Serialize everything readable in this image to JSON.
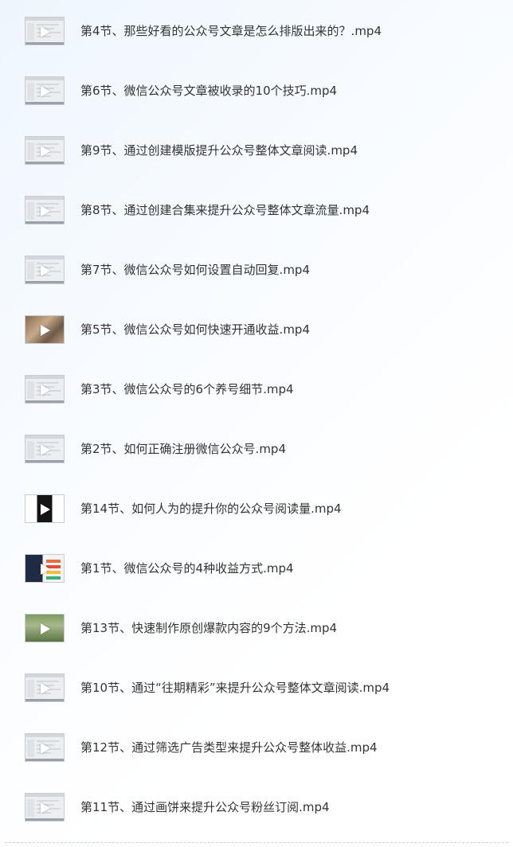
{
  "files": [
    {
      "name": "第4节、那些好看的公众号文章是怎么排版出来的？.mp4",
      "thumb_style": "screen"
    },
    {
      "name": "第6节、微信公众号文章被收录的10个技巧.mp4",
      "thumb_style": "screen"
    },
    {
      "name": "第9节、通过创建模版提升公众号整体文章阅读.mp4",
      "thumb_style": "screen"
    },
    {
      "name": "第8节、通过创建合集来提升公众号整体文章流量.mp4",
      "thumb_style": "screen"
    },
    {
      "name": "第7节、微信公众号如何设置自动回复.mp4",
      "thumb_style": "screen"
    },
    {
      "name": "第5节、微信公众号如何快速开通收益.mp4",
      "thumb_style": "photo"
    },
    {
      "name": "第3节、微信公众号的6个养号细节.mp4",
      "thumb_style": "screen"
    },
    {
      "name": "第2节、如何正确注册微信公众号.mp4",
      "thumb_style": "screen"
    },
    {
      "name": "第14节、如何人为的提升你的公众号阅读量.mp4",
      "thumb_style": "dark"
    },
    {
      "name": "第1节、微信公众号的4种收益方式.mp4",
      "thumb_style": "navy"
    },
    {
      "name": "第13节、快速制作原创爆款内容的9个方法.mp4",
      "thumb_style": "green"
    },
    {
      "name": "第10节、通过“往期精彩”来提升公众号整体文章阅读.mp4",
      "thumb_style": "screen"
    },
    {
      "name": "第12节、通过筛选广告类型来提升公众号整体收益.mp4",
      "thumb_style": "screen"
    },
    {
      "name": "第11节、通过画饼来提升公众号粉丝订阅.mp4",
      "thumb_style": "screen"
    }
  ]
}
